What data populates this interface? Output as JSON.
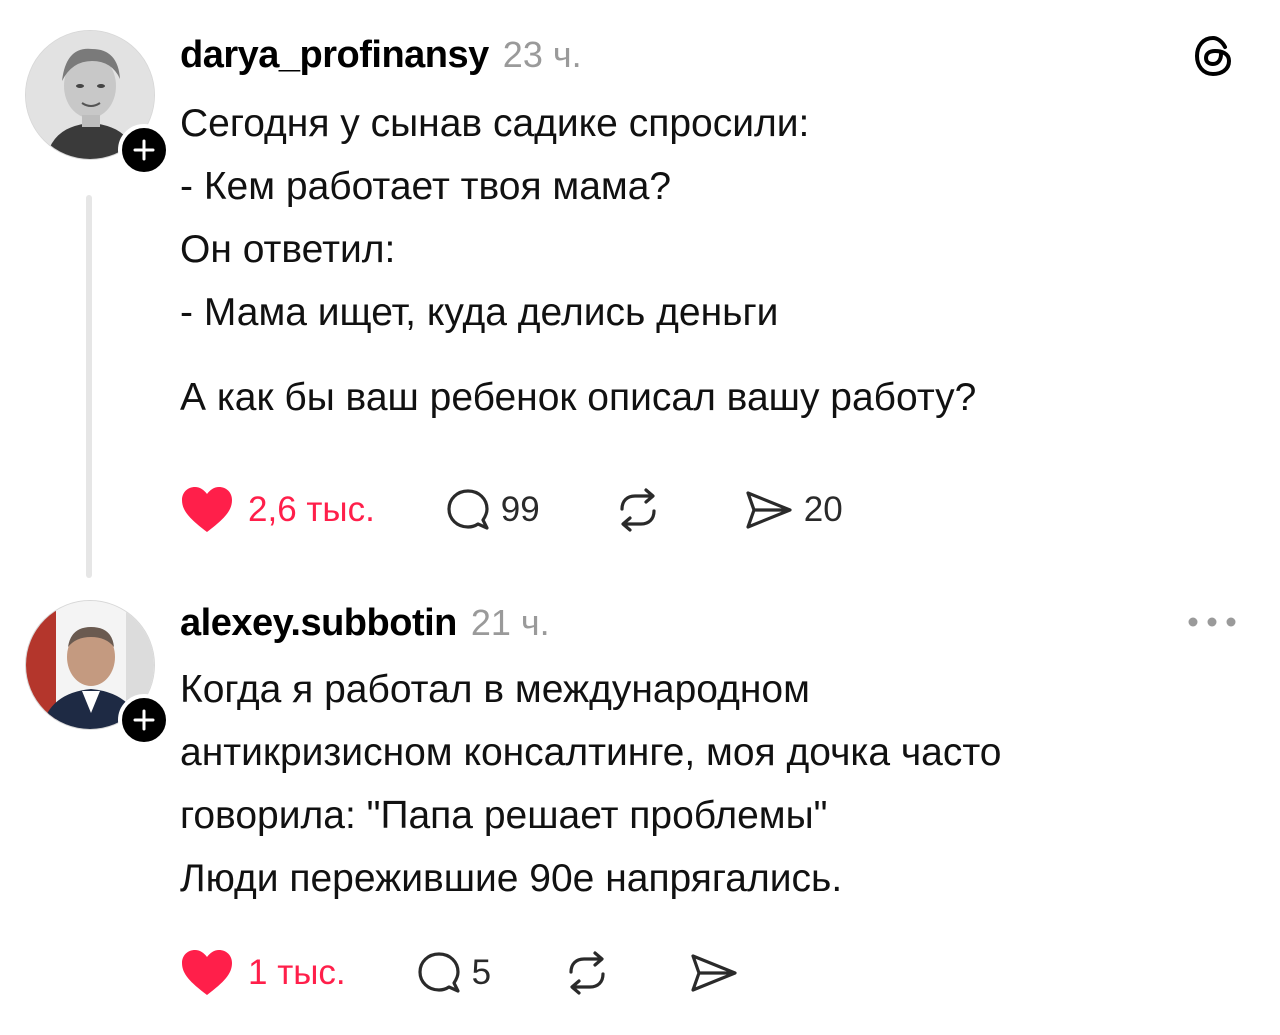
{
  "posts": [
    {
      "username": "darya_profinansy",
      "time": "23 ч.",
      "lines": [
        "Сегодня у сынав садике спросили:",
        "- Кем работает твоя мама?",
        "Он ответил:",
        "- Мама ищет, куда делись деньги",
        "А как бы ваш ребенок описал вашу работу?"
      ],
      "likes": "2,6 тыс.",
      "replies": "99",
      "reposts": "",
      "shares": "20",
      "corner_icon": "threads-logo-icon"
    },
    {
      "username": "alexey.subbotin",
      "time": "21 ч.",
      "lines": [
        "Когда я работал в международном",
        "антикризисном консалтинге, моя дочка часто",
        "говорила: \"Папа решает проблемы\"",
        "Люди пережившие 90е напрягались."
      ],
      "likes": "1 тыс.",
      "replies": "5",
      "reposts": "",
      "shares": "",
      "corner_icon": "more-options-icon"
    }
  ],
  "colors": {
    "like": "#ff1f4a",
    "muted": "#9a9a9a",
    "thread_line": "#e6e6e6"
  }
}
